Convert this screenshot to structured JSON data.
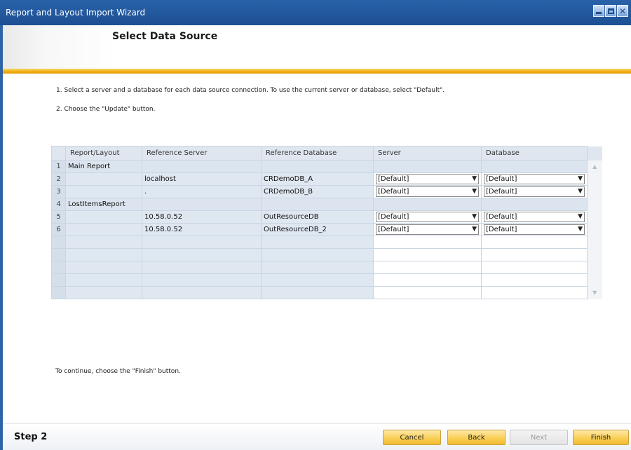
{
  "window": {
    "title": "Report and Layout Import Wizard"
  },
  "page": {
    "heading": "Select Data Source"
  },
  "instructions": [
    "1. Select a server and a database for each data source connection. To use the current server or database, select \"Default\".",
    "2. Choose the \"Update\" button."
  ],
  "grid": {
    "columns": [
      "Report/Layout",
      "Reference Server",
      "Reference Database",
      "Server",
      "Database"
    ],
    "rows": [
      {
        "num": "1",
        "layout": "Main Report",
        "ref_server": "",
        "ref_db": "",
        "server": "",
        "database": ""
      },
      {
        "num": "2",
        "layout": "",
        "ref_server": "localhost",
        "ref_db": "CRDemoDB_A",
        "server": "[Default]",
        "database": "[Default]"
      },
      {
        "num": "3",
        "layout": "",
        "ref_server": ".",
        "ref_db": "CRDemoDB_B",
        "server": "[Default]",
        "database": "[Default]"
      },
      {
        "num": "4",
        "layout": "LostItemsReport",
        "ref_server": "",
        "ref_db": "",
        "server": "",
        "database": ""
      },
      {
        "num": "5",
        "layout": "",
        "ref_server": "10.58.0.52",
        "ref_db": "OutResourceDB",
        "server": "[Default]",
        "database": "[Default]"
      },
      {
        "num": "6",
        "layout": "",
        "ref_server": "10.58.0.52",
        "ref_db": "OutResourceDB_2",
        "server": "[Default]",
        "database": "[Default]"
      }
    ],
    "empty_rows": 5
  },
  "footer_note": "To continue, choose the \"Finish\" button.",
  "step_label": "Step 2",
  "buttons": {
    "cancel": "Cancel",
    "back": "Back",
    "next": "Next",
    "finish": "Finish"
  },
  "icons": {
    "minimize": "minimize-icon",
    "maximize": "maximize-icon",
    "close": "close-icon",
    "dropdown": "dropdown-arrow-icon"
  },
  "colors": {
    "titlebar": "#1f5399",
    "accent_bar": "#f0b019",
    "button": "#f9cf57"
  }
}
